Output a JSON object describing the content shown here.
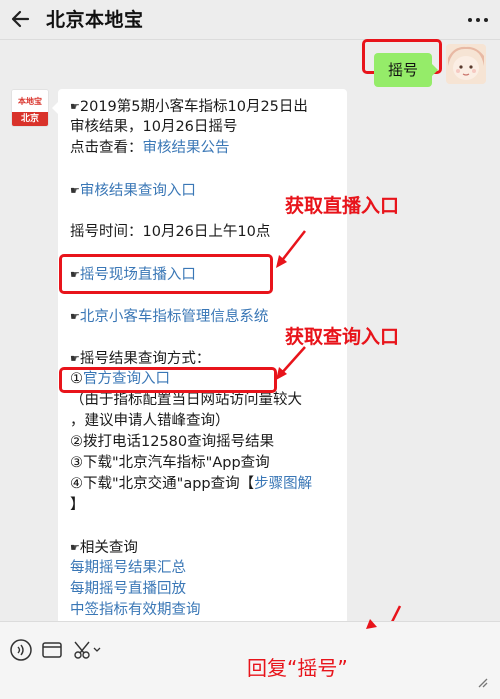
{
  "header": {
    "title": "北京本地宝"
  },
  "outgoing": {
    "text": "摇号"
  },
  "account": {
    "avatar_top": "本地宝",
    "avatar_bottom": "北京"
  },
  "card": {
    "line1": "2019第5期小客车指标10月25日出",
    "line2": "审核结果，10月26日摇号",
    "line3_prefix": "点击查看：",
    "line3_link": "审核结果公告",
    "link_review_query": "审核结果查询入口",
    "draw_time": "摇号时间：10月26日上午10点",
    "link_live": "摇号现场直播入口",
    "link_system": "北京小客车指标管理信息系统",
    "query_methods": "摇号结果查询方式：",
    "method1_num": "①",
    "method1_link": "官方查询入口",
    "method1_note1": "（由于指标配置当日网站访问量较大",
    "method1_note2": "，建议申请人错峰查询）",
    "method2": "②拨打电话12580查询摇号结果",
    "method3": "③下载\"北京汽车指标\"App查询",
    "method4_prefix": "④下载\"北京交通\"app查询【",
    "method4_link": "步骤图解",
    "method4_close": "】",
    "related": "相关查询",
    "related_link1": "每期摇号结果汇总",
    "related_link2": "每期摇号直播回放",
    "related_link3": "中签指标有效期查询"
  },
  "annotations": {
    "live_entry": "获取直播入口",
    "query_entry": "获取查询入口",
    "reply": "回复“摇号”"
  },
  "icons": {
    "back": "back-arrow-icon",
    "more": "more-dots-icon",
    "voice": "voice-icon",
    "menu": "menu-icon",
    "scissors": "scissors-icon",
    "hand": "pointing-hand-icon"
  },
  "colors": {
    "accent_red": "#e8141b",
    "link_blue": "#3a77b6",
    "bubble_green": "#95ec69"
  }
}
